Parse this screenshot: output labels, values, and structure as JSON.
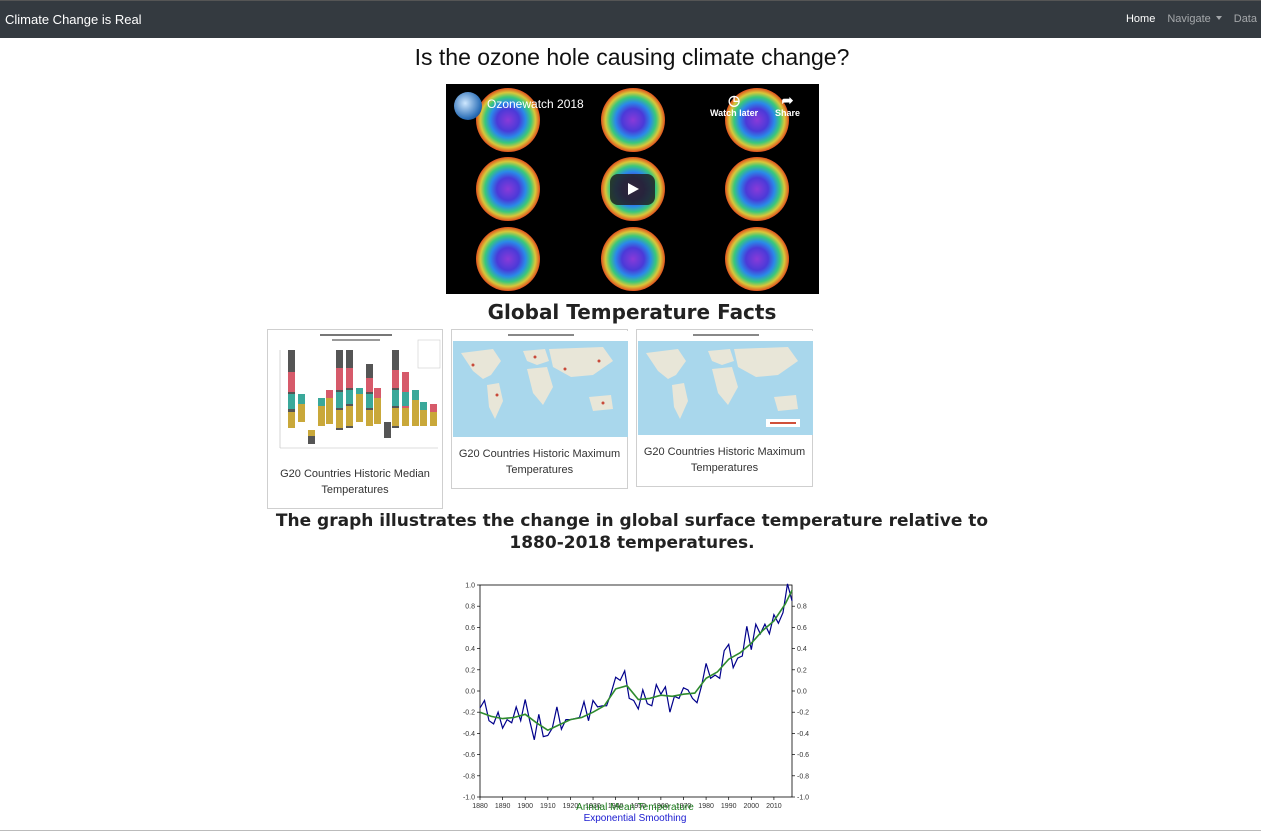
{
  "navbar": {
    "brand": "Climate Change is Real",
    "links": [
      "Home",
      "Navigate",
      "Data"
    ]
  },
  "main": {
    "heading": "Is the ozone hole causing climate change?"
  },
  "video": {
    "title": "Ozonewatch 2018",
    "watch_later": "Watch later",
    "share": "Share"
  },
  "facts": {
    "heading": "Global Temperature Facts",
    "cards": [
      {
        "caption": "G20 Countries Historic Median Temperatures"
      },
      {
        "caption": "G20 Countries Historic Maximum Temperatures"
      },
      {
        "caption": "G20 Countries Historic Maximum Temperatures"
      }
    ]
  },
  "graph": {
    "heading": "The graph illustrates the change in global surface temperature relative to 1880-2018 temperatures.",
    "legend_annual": "Annual Mean Temperature",
    "legend_smooth": "Exponential Smoothing"
  },
  "colors": {
    "navbar": "#343a40",
    "annual_line": "#00008b",
    "smooth_line": "#2e8b2e"
  },
  "chart_data": {
    "type": "line",
    "title": "",
    "xlabel": "",
    "ylabel": "",
    "xlim": [
      1880,
      2018
    ],
    "ylim": [
      -1.0,
      1.0
    ],
    "x_ticks": [
      1880,
      1890,
      1900,
      1910,
      1920,
      1930,
      1940,
      1950,
      1960,
      1970,
      1980,
      1990,
      2000,
      2010
    ],
    "y_ticks": [
      -1.0,
      -0.8,
      -0.6,
      -0.4,
      -0.2,
      0.0,
      0.2,
      0.4,
      0.6,
      0.8,
      1.0
    ],
    "y_tick_labels": [
      "-1.0",
      "-0.8",
      "-0.6",
      "-0.4",
      "-0.2",
      "0.0",
      "0.2",
      "0.4",
      "0.6",
      "0.8",
      "1.0"
    ],
    "x_tick_labels": [
      "1880",
      "1890",
      "1900",
      "1910",
      "1920",
      "1930",
      "1940",
      "1950",
      "1960",
      "1970",
      "1980",
      "1990",
      "2000",
      "2010"
    ],
    "right_y_tick_labels": [
      "-1.0",
      "-0.8",
      "-0.6",
      "-0.4",
      "-0.2",
      "0.0",
      "0.2",
      "0.4",
      "0.6",
      "0.8"
    ],
    "series": [
      {
        "name": "Annual Mean Temperature",
        "x": [
          1880,
          1882,
          1884,
          1886,
          1888,
          1890,
          1892,
          1894,
          1896,
          1898,
          1900,
          1902,
          1904,
          1906,
          1908,
          1910,
          1912,
          1914,
          1916,
          1918,
          1920,
          1922,
          1924,
          1926,
          1928,
          1930,
          1932,
          1934,
          1936,
          1938,
          1940,
          1942,
          1944,
          1946,
          1948,
          1950,
          1952,
          1954,
          1956,
          1958,
          1960,
          1962,
          1964,
          1966,
          1968,
          1970,
          1972,
          1974,
          1976,
          1978,
          1980,
          1982,
          1984,
          1986,
          1988,
          1990,
          1992,
          1994,
          1996,
          1998,
          2000,
          2002,
          2004,
          2006,
          2008,
          2010,
          2012,
          2014,
          2016,
          2018
        ],
        "y": [
          -0.16,
          -0.09,
          -0.28,
          -0.31,
          -0.2,
          -0.35,
          -0.27,
          -0.3,
          -0.15,
          -0.28,
          -0.08,
          -0.28,
          -0.46,
          -0.22,
          -0.43,
          -0.42,
          -0.35,
          -0.15,
          -0.36,
          -0.27,
          -0.27,
          -0.26,
          -0.25,
          -0.1,
          -0.28,
          -0.09,
          -0.15,
          -0.14,
          -0.14,
          -0.02,
          0.13,
          0.1,
          0.19,
          -0.07,
          -0.09,
          -0.17,
          0.01,
          -0.12,
          -0.14,
          0.06,
          -0.03,
          0.04,
          -0.2,
          -0.05,
          -0.07,
          0.03,
          0.01,
          -0.07,
          -0.11,
          0.05,
          0.26,
          0.12,
          0.15,
          0.12,
          0.38,
          0.44,
          0.22,
          0.31,
          0.33,
          0.61,
          0.39,
          0.63,
          0.54,
          0.63,
          0.54,
          0.72,
          0.64,
          0.74,
          1.01,
          0.85
        ]
      },
      {
        "name": "Exponential Smoothing",
        "x": [
          1880,
          1885,
          1890,
          1895,
          1900,
          1905,
          1910,
          1915,
          1920,
          1925,
          1930,
          1935,
          1940,
          1945,
          1950,
          1955,
          1960,
          1965,
          1970,
          1975,
          1980,
          1985,
          1990,
          1995,
          2000,
          2005,
          2010,
          2015,
          2018
        ],
        "y": [
          -0.2,
          -0.24,
          -0.26,
          -0.25,
          -0.22,
          -0.3,
          -0.37,
          -0.32,
          -0.27,
          -0.25,
          -0.2,
          -0.14,
          0.02,
          0.05,
          -0.08,
          -0.07,
          -0.04,
          -0.05,
          -0.03,
          -0.02,
          0.12,
          0.18,
          0.3,
          0.36,
          0.45,
          0.57,
          0.66,
          0.82,
          0.95
        ]
      }
    ]
  }
}
